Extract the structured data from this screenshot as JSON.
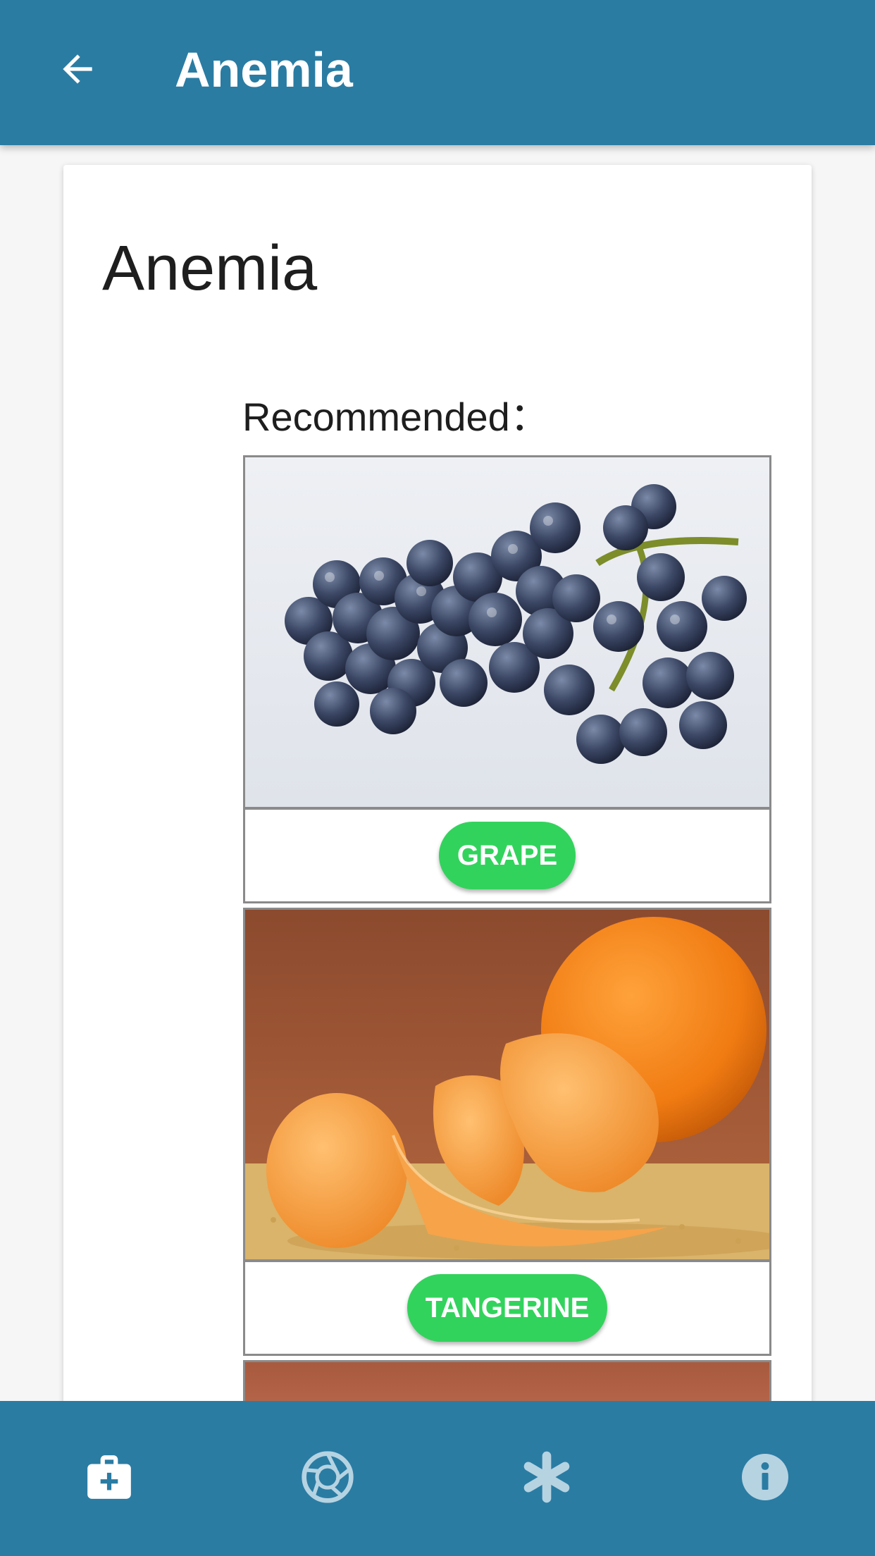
{
  "appbar": {
    "title": "Anemia",
    "back_icon": "arrow-left-icon",
    "background": "#2a7ca3"
  },
  "card": {
    "title": "Anemia",
    "recommended_label": "Recommended："
  },
  "foods": [
    {
      "name": "GRAPE",
      "image": "grape-photo"
    },
    {
      "name": "TANGERINE",
      "image": "tangerine-photo"
    }
  ],
  "colors": {
    "accent": "#2a7ca3",
    "button_green": "#32d35c"
  },
  "bottom_nav": {
    "items": [
      {
        "icon": "medical-kit-icon",
        "active": true
      },
      {
        "icon": "camera-aperture-icon",
        "active": false
      },
      {
        "icon": "asterisk-icon",
        "active": false
      },
      {
        "icon": "info-icon",
        "active": false
      }
    ]
  }
}
